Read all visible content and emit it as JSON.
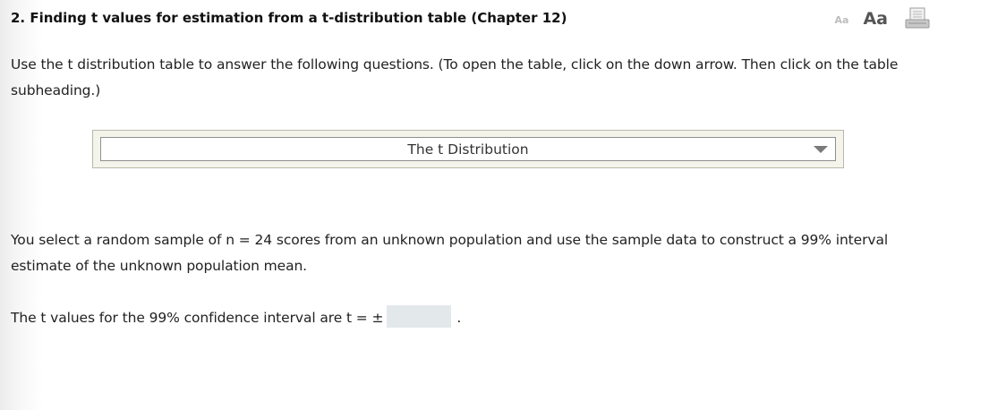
{
  "question": {
    "title": "2.  Finding t values for estimation from a t-distribution table (Chapter 12)"
  },
  "toolbar": {
    "font_small_label": "Aa",
    "font_large_label": "Aa",
    "print_icon": "print-icon"
  },
  "instructions": "Use the t distribution table to answer the following questions. (To open the table, click on the down arrow. Then click on the table subheading.)",
  "table_dropdown": {
    "label": "The t Distribution",
    "icon": "chevron-down-icon"
  },
  "problem": {
    "text": "You select a random sample of n = 24 scores from an unknown population and use the sample data to construct a 99% interval estimate of the unknown population mean.",
    "prompt_prefix": "The t values for the 99% confidence interval are t = ±",
    "prompt_suffix": ".",
    "answer_value": ""
  },
  "colors": {
    "dropdown_frame": "#f5f4ea",
    "input_background": "#e3e8ea"
  }
}
